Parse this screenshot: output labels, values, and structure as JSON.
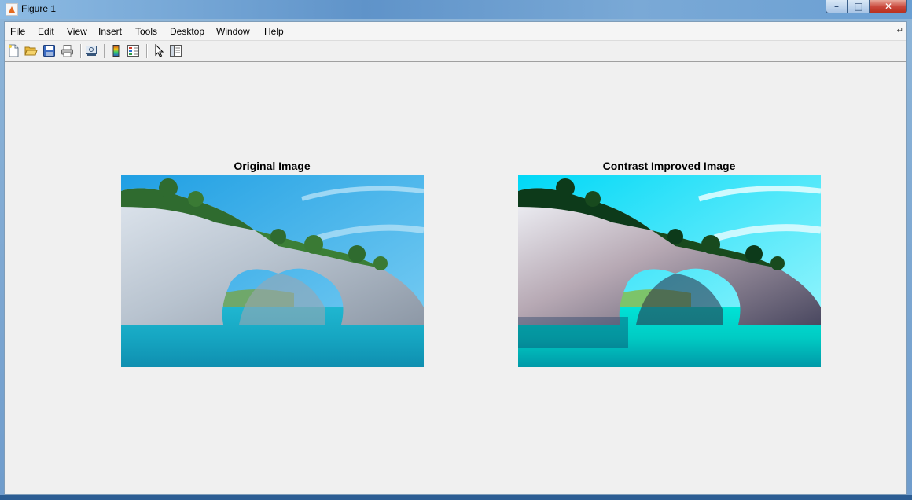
{
  "window": {
    "title": "Figure 1"
  },
  "menu": {
    "items": [
      "File",
      "Edit",
      "View",
      "Insert",
      "Tools",
      "Desktop",
      "Window",
      "Help"
    ]
  },
  "toolbar": {
    "icons": [
      "new-figure-icon",
      "open-file-icon",
      "save-figure-icon",
      "print-figure-icon",
      "print-preview-icon",
      "insert-colorbar-icon",
      "insert-legend-icon",
      "edit-plot-icon",
      "show-plot-tools-icon"
    ]
  },
  "figure": {
    "subplots": [
      {
        "title": "Original Image"
      },
      {
        "title": "Contrast Improved Image"
      }
    ]
  },
  "colors": {
    "figure_background": "#f0f0f0",
    "sky_original": "#3db8ee",
    "sky_enhanced": "#14e8f6",
    "water_original": "#1aa7c0",
    "water_enhanced": "#00d6c8"
  }
}
